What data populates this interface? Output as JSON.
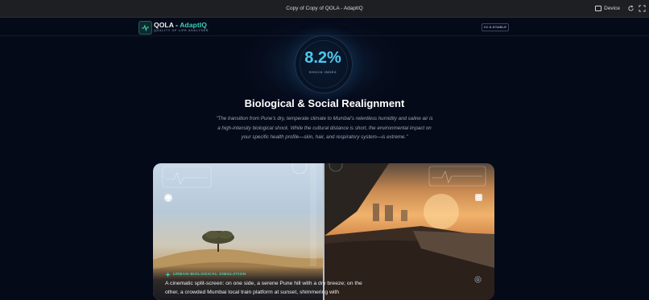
{
  "window": {
    "title": "Copy of Copy of QOLA - AdaptIQ",
    "device_label": "Device"
  },
  "header": {
    "brand_main": "QOLA",
    "brand_sep": " - ",
    "brand_accent": "AdaptIQ",
    "tagline": "QUALITY OF LIFE ANALYSER",
    "version": "V2.5-STABLE"
  },
  "gauge": {
    "value": "8.2%",
    "label": "SHOCK INDEX"
  },
  "section": {
    "heading": "Biological & Social Realignment",
    "quote": "\"The transition from Pune's dry, temperate climate to Mumbai's relentless humidity and saline air is a high-intensity biological shock. While the cultural distance is short, the environmental impact on your specific health profile—skin, hair, and respiratory system—is extreme.\""
  },
  "simulation": {
    "tag": "URBAN-BIOLOGICAL SIMULATION",
    "description": "A cinematic split-screen: on one side, a serene Pune hill with a dry breeze; on the other, a crowded Mumbai local train platform at sunset, shimmering with"
  },
  "icons": [
    "activity-icon",
    "device-icon",
    "refresh-icon",
    "fullscreen-icon",
    "heart-icon",
    "gallery-icon",
    "settings-icon",
    "sparkle-icon"
  ],
  "colors": {
    "accent_teal": "#36d3bd",
    "gauge_blue": "#4cc8ee",
    "background": "#050a19"
  }
}
